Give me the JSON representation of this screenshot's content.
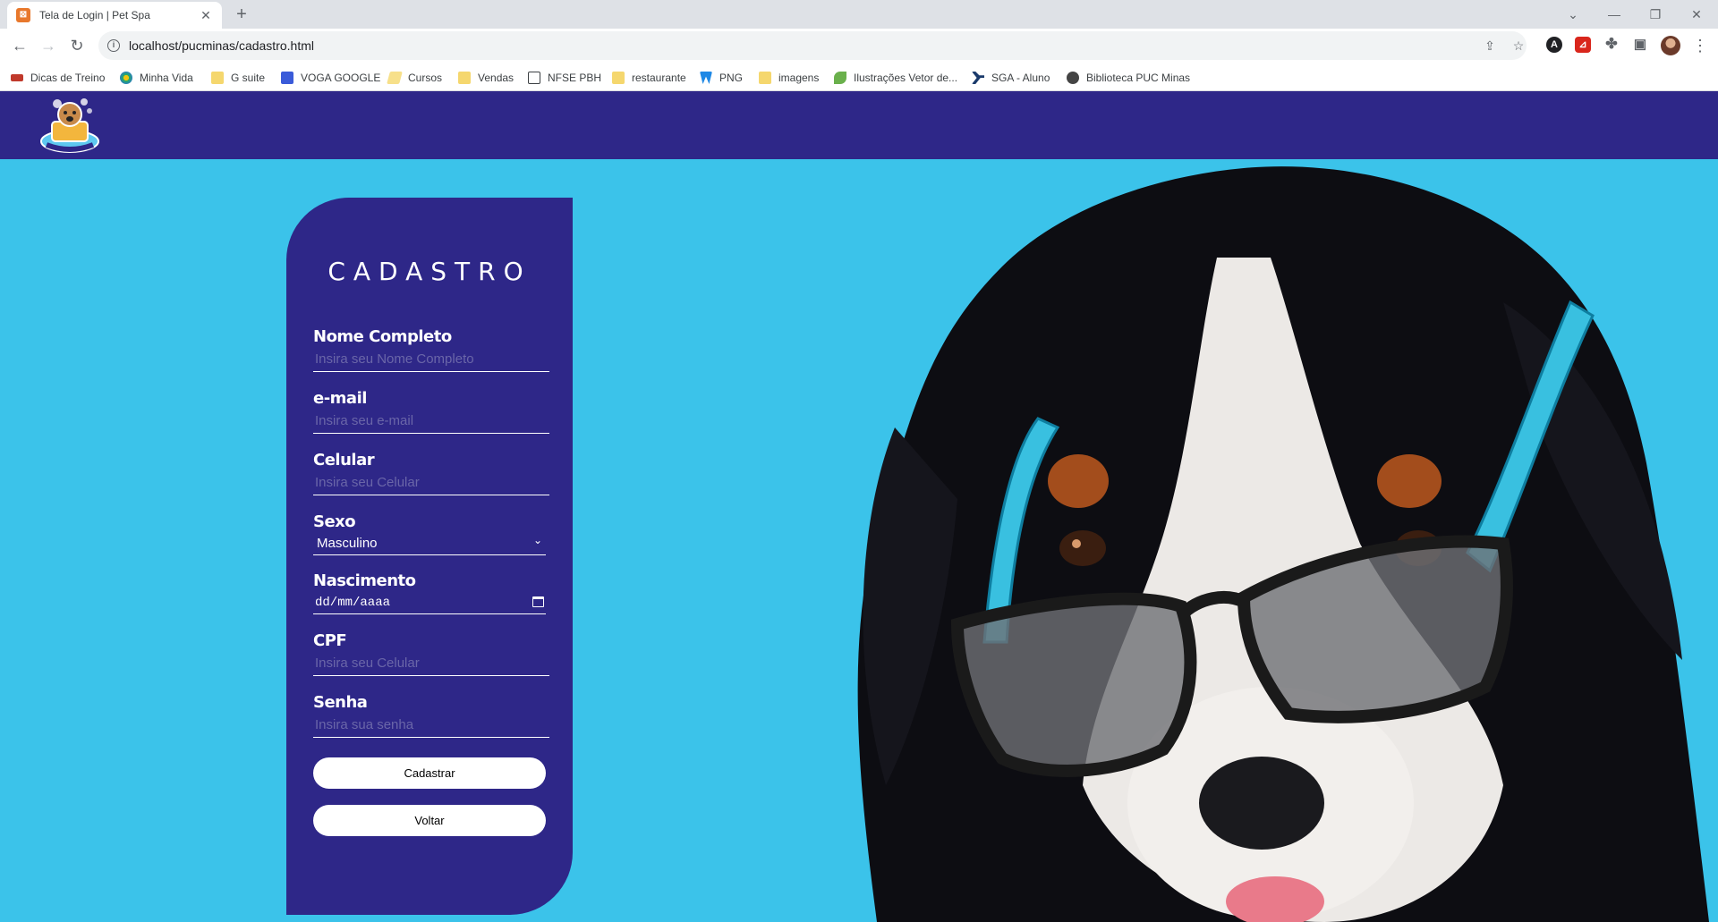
{
  "browser": {
    "tab_title": "Tela de Login | Pet Spa",
    "url": "localhost/pucminas/cadastro.html",
    "bookmarks": [
      {
        "label": "Dicas de Treino",
        "icon": "red-bookmark-icon"
      },
      {
        "label": "Minha Vida",
        "icon": "flower-icon"
      },
      {
        "label": "G suite",
        "icon": "folder-icon"
      },
      {
        "label": "VOGA GOOGLE",
        "icon": "blue-page-icon"
      },
      {
        "label": "Cursos",
        "icon": "open-folder-icon"
      },
      {
        "label": "Vendas",
        "icon": "folder-icon"
      },
      {
        "label": "NFSE PBH",
        "icon": "document-icon"
      },
      {
        "label": "restaurante",
        "icon": "folder-icon"
      },
      {
        "label": "PNG",
        "icon": "w-logo-icon"
      },
      {
        "label": "imagens",
        "icon": "folder-icon"
      },
      {
        "label": "Ilustrações Vetor de...",
        "icon": "leaf-icon"
      },
      {
        "label": "SGA - Aluno",
        "icon": "branch-icon"
      },
      {
        "label": "Biblioteca PUC Minas",
        "icon": "globe-icon"
      }
    ]
  },
  "form": {
    "title": "CADASTRO",
    "fields": [
      {
        "label": "Nome Completo",
        "placeholder": "Insira seu Nome Completo"
      },
      {
        "label": "e-mail",
        "placeholder": "Insira seu e-mail"
      },
      {
        "label": "Celular",
        "placeholder": "Insira seu Celular"
      },
      {
        "label": "Sexo",
        "value": "Masculino"
      },
      {
        "label": "Nascimento",
        "value": "dd/mm/aaaa"
      },
      {
        "label": "CPF",
        "placeholder": "Insira seu Celular"
      },
      {
        "label": "Senha",
        "placeholder": "Insira sua senha"
      }
    ],
    "submit_label": "Cadastrar",
    "back_label": "Voltar"
  },
  "colors": {
    "header_bg": "#2e2788",
    "hero_bg": "#3bc3ea",
    "panel_bg": "#2e2788"
  }
}
